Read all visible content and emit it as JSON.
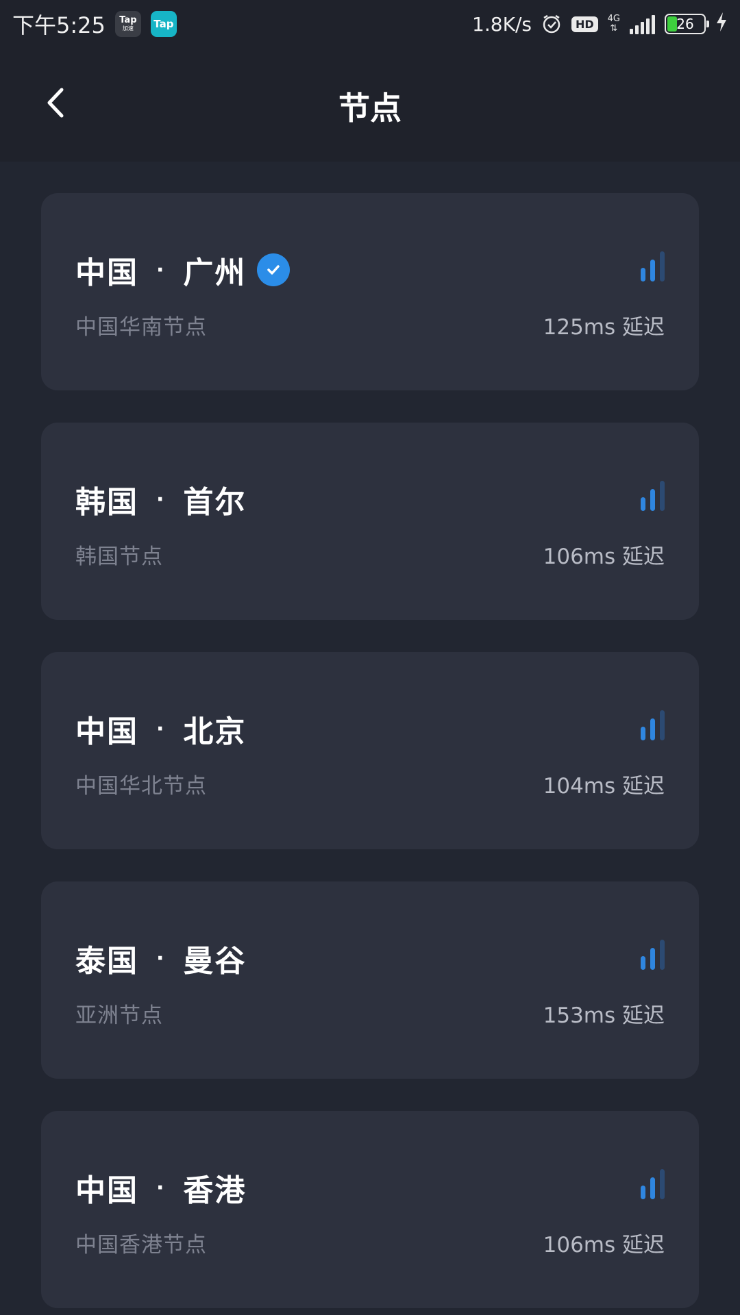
{
  "status_bar": {
    "time": "下午5:25",
    "app1_top": "Tap",
    "app1_bottom": "加速",
    "app2": "Tap",
    "net_speed": "1.8K/s",
    "hd": "HD",
    "network": "4G",
    "battery": "26",
    "icons": [
      "alarm-icon",
      "hd-icon",
      "signal-icon",
      "battery-icon",
      "charging-icon"
    ]
  },
  "header": {
    "title": "节点",
    "back_icon": "chevron-left-icon"
  },
  "latency_suffix": "延迟",
  "signal": {
    "active_color": "#2f86e0",
    "inactive_color": "#2c4a72",
    "active_bars": 2,
    "total_bars": 3
  },
  "nodes": [
    {
      "country": "中国",
      "city": "广州",
      "desc": "中国华南节点",
      "latency": "125ms 延迟",
      "selected": true
    },
    {
      "country": "韩国",
      "city": "首尔",
      "desc": "韩国节点",
      "latency": "106ms 延迟",
      "selected": false
    },
    {
      "country": "中国",
      "city": "北京",
      "desc": "中国华北节点",
      "latency": "104ms 延迟",
      "selected": false
    },
    {
      "country": "泰国",
      "city": "曼谷",
      "desc": "亚洲节点",
      "latency": "153ms 延迟",
      "selected": false
    },
    {
      "country": "中国",
      "city": "香港",
      "desc": "中国香港节点",
      "latency": "106ms 延迟",
      "selected": false
    }
  ],
  "separator": "·"
}
